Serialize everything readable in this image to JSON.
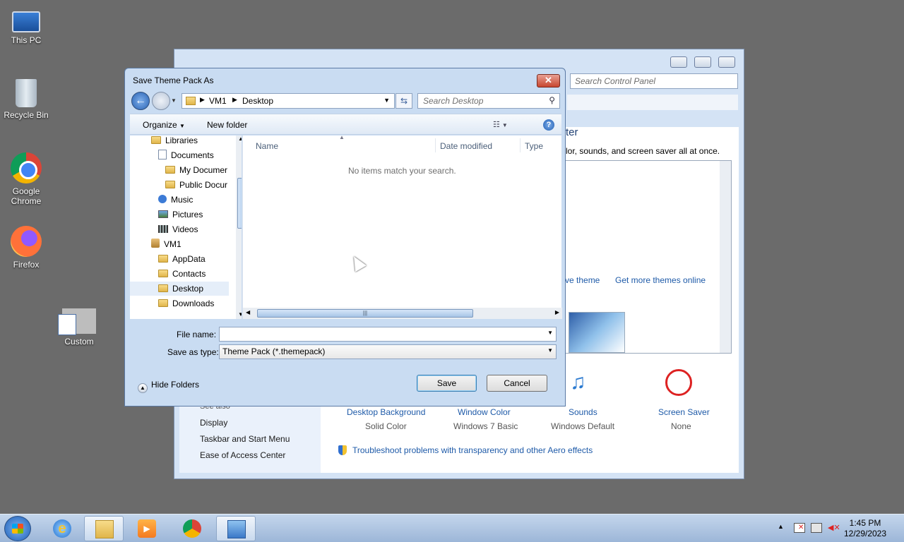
{
  "desktop": {
    "icons": [
      {
        "label": "This PC"
      },
      {
        "label": "Recycle Bin"
      },
      {
        "label": "Google Chrome"
      },
      {
        "label": "Firefox"
      },
      {
        "label": "Custom"
      }
    ]
  },
  "control_panel": {
    "search_placeholder": "Search Control Panel",
    "heading_partial": "ter",
    "description_partial": "lor, sounds, and screen saver all at once.",
    "save_theme_partial": "ve theme",
    "get_more_themes": "Get more themes online",
    "see_also_partial": "See also",
    "left_links": [
      "Display",
      "Taskbar and Start Menu",
      "Ease of Access Center"
    ],
    "items": [
      {
        "label": "Desktop Background",
        "value": "Solid Color"
      },
      {
        "label": "Window Color",
        "value": "Windows 7 Basic"
      },
      {
        "label": "Sounds",
        "value": "Windows Default"
      },
      {
        "label": "Screen Saver",
        "value": "None"
      }
    ],
    "troubleshoot_link": "Troubleshoot problems with transparency and other Aero effects"
  },
  "dialog": {
    "title": "Save Theme Pack As",
    "close_glyph": "✕",
    "breadcrumb": [
      "VM1",
      "Desktop"
    ],
    "search_placeholder": "Search Desktop",
    "organize_label": "Organize",
    "new_folder_label": "New folder",
    "tree": [
      {
        "label": "Libraries",
        "icon": "folder"
      },
      {
        "label": "Documents",
        "icon": "doc"
      },
      {
        "label": "My Documer",
        "icon": "folder"
      },
      {
        "label": "Public Docur",
        "icon": "folder"
      },
      {
        "label": "Music",
        "icon": "music"
      },
      {
        "label": "Pictures",
        "icon": "pict"
      },
      {
        "label": "Videos",
        "icon": "vid"
      },
      {
        "label": "VM1",
        "icon": "user"
      },
      {
        "label": "AppData",
        "icon": "folder"
      },
      {
        "label": "Contacts",
        "icon": "folder"
      },
      {
        "label": "Desktop",
        "icon": "folder",
        "selected": true
      },
      {
        "label": "Downloads",
        "icon": "folder"
      }
    ],
    "columns": [
      "Name",
      "Date modified",
      "Type"
    ],
    "empty_message": "No items match your search.",
    "file_name_label": "File name:",
    "file_name_value": "",
    "save_as_type_label": "Save as type:",
    "save_as_type_value": "Theme Pack (*.themepack)",
    "hide_folders_label": "Hide Folders",
    "save_button": "Save",
    "cancel_button": "Cancel"
  },
  "taskbar": {
    "clock_time": "1:45 PM",
    "clock_date": "12/29/2023"
  },
  "colors": {
    "accent": "#1e5aa8",
    "title_bar": "#c9dcf2",
    "desktop": "#6b6b6b"
  }
}
